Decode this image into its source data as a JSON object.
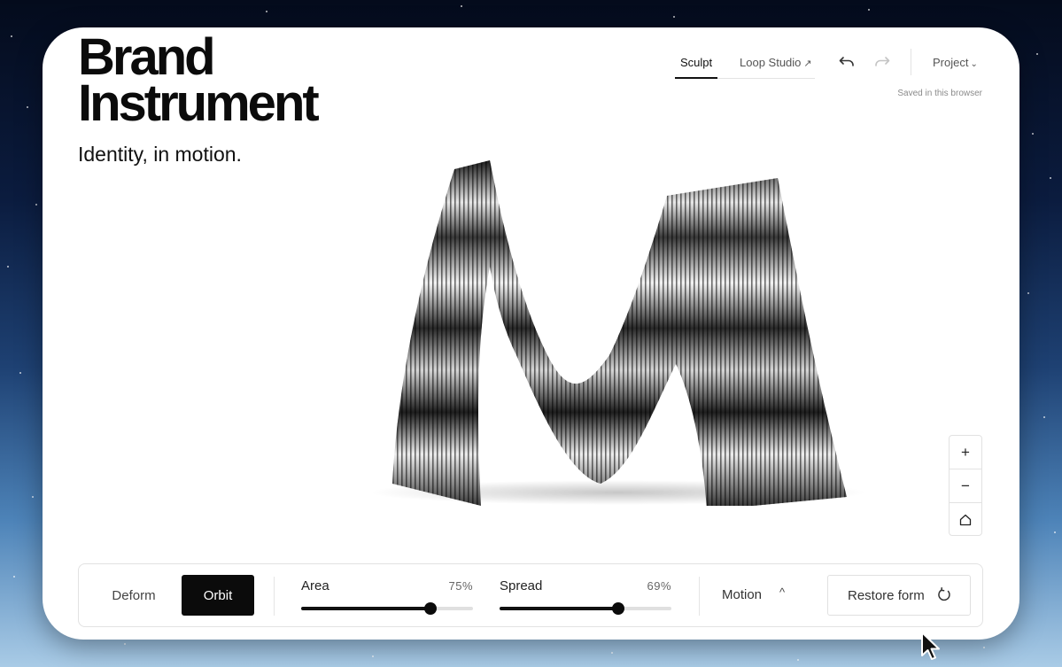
{
  "brand": {
    "title_line1": "Brand",
    "title_line2": "Instrument",
    "subtitle": "Identity, in motion."
  },
  "nav": {
    "tabs": [
      {
        "label": "Sculpt",
        "active": true
      },
      {
        "label": "Loop Studio",
        "external_icon": "external-link-icon"
      }
    ],
    "project_label": "Project",
    "saved_status": "Saved in this browser"
  },
  "icons": {
    "undo": "undo-icon",
    "redo": "redo-icon",
    "zoom_in": "plus-icon",
    "zoom_out": "minus-icon",
    "home": "home-icon",
    "restore": "refresh-icon",
    "project_chevron": "chevron-down-icon"
  },
  "zoom": {
    "in_label": "+",
    "out_label": "−"
  },
  "toolbar": {
    "modes": [
      {
        "label": "Deform",
        "active": false
      },
      {
        "label": "Orbit",
        "active": true
      }
    ],
    "sliders": [
      {
        "label": "Area",
        "value": 75,
        "unit": "%"
      },
      {
        "label": "Spread",
        "value": 69,
        "unit": "%"
      }
    ],
    "motion_label": "Motion",
    "restore_label": "Restore form"
  },
  "colors": {
    "accent": "#0b0b0b",
    "panel_bg": "#ffffff",
    "border": "#e2e2e2",
    "muted_text": "#8a8a8a"
  }
}
